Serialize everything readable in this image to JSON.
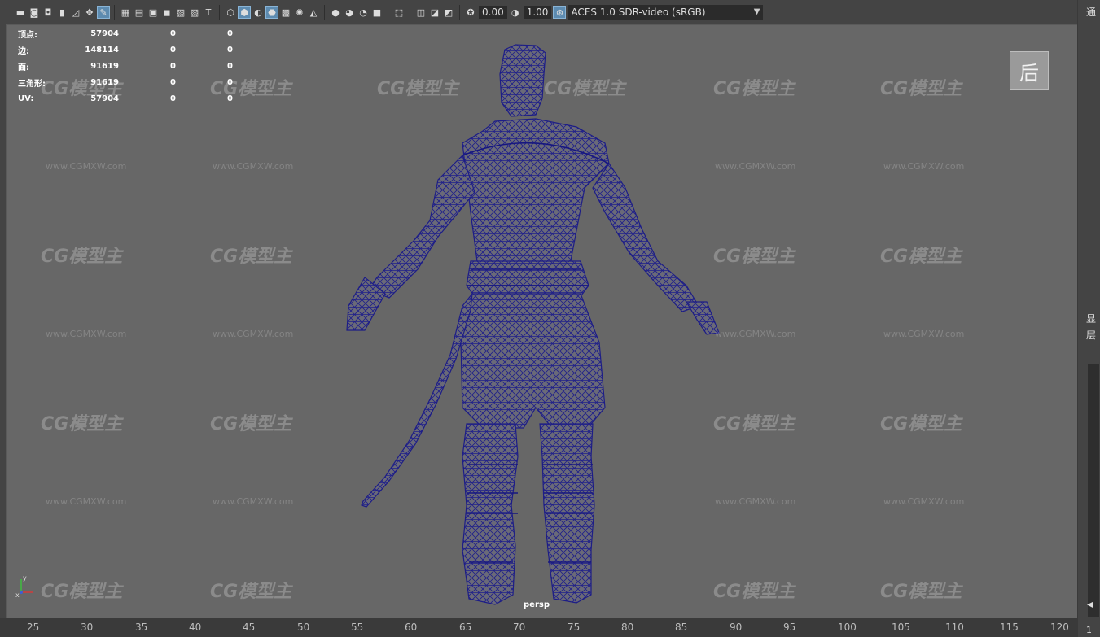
{
  "toolbar": {
    "exposure_value": "0.00",
    "gamma_value": "1.00",
    "color_space": "ACES 1.0 SDR-video (sRGB)",
    "icons": [
      "camera-icon",
      "camera-attributes-icon",
      "bookmark-icon",
      "image-plane-icon",
      "pan-zoom-icon",
      "grease-pencil-icon",
      "grid-icon",
      "film-gate-icon",
      "resolution-gate-icon",
      "gate-mask-icon",
      "field-chart-icon",
      "safe-action-icon",
      "safe-title-icon",
      "wireframe-icon",
      "smooth-shade-icon",
      "default-material-icon",
      "wireframe-on-shaded-icon",
      "textured-icon",
      "use-all-lights-icon",
      "shadows-icon",
      "screen-space-ao-icon",
      "motion-blur-icon",
      "anti-aliasing-icon",
      "depth-of-field-icon",
      "isolate-select-icon",
      "xray-icon",
      "xray-joints-icon",
      "xray-components-icon",
      "exposure-icon",
      "gamma-icon",
      "color-management-icon"
    ]
  },
  "hud": {
    "rows": [
      {
        "label": "顶点:",
        "value": "57904",
        "c1": "0",
        "c2": "0"
      },
      {
        "label": "边:",
        "value": "148114",
        "c1": "0",
        "c2": "0"
      },
      {
        "label": "面:",
        "value": "91619",
        "c1": "0",
        "c2": "0"
      },
      {
        "label": "三角形:",
        "value": "91619",
        "c1": "0",
        "c2": "0"
      },
      {
        "label": "UV:",
        "value": "57904",
        "c1": "0",
        "c2": "0"
      }
    ]
  },
  "viewport": {
    "camera_label": "persp",
    "view_cube_label": "后",
    "mesh_color": "#20208c",
    "background_color": "#676767"
  },
  "watermark": {
    "logo": "CG模型主",
    "url": "www.CGMXW.com"
  },
  "axis": {
    "x": "x",
    "y": "y"
  },
  "timeline": {
    "ticks": [
      "25",
      "30",
      "35",
      "40",
      "45",
      "50",
      "55",
      "60",
      "65",
      "70",
      "75",
      "80",
      "85",
      "90",
      "95",
      "100",
      "105",
      "110",
      "115",
      "120"
    ]
  },
  "side_panel": {
    "top_label": "通",
    "label_1": "显",
    "label_2": "层",
    "bottom_value": "1"
  }
}
